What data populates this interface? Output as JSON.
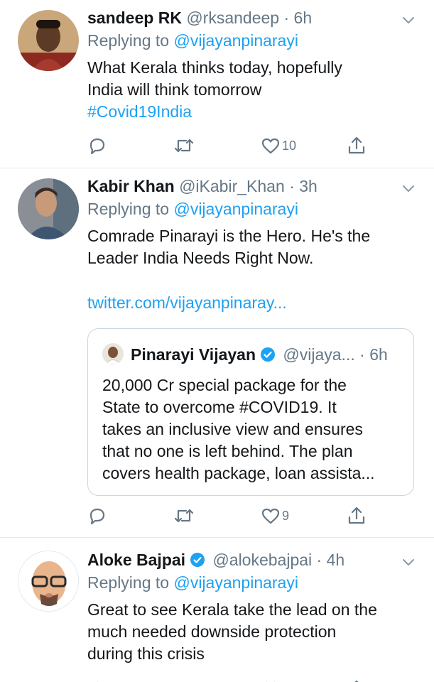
{
  "tweets": [
    {
      "name": "sandeep RK",
      "handle": "@rksandeep",
      "time": "6h",
      "replying_prefix": "Replying to ",
      "replying_to": "@vijayanpinarayi",
      "text": "What Kerala thinks today, hopefully\nIndia will think tomorrow",
      "hashtag": "#Covid19India",
      "like_count": "10"
    },
    {
      "name": "Kabir Khan",
      "handle": "@iKabir_Khan",
      "time": "3h",
      "replying_prefix": "Replying to ",
      "replying_to": "@vijayanpinarayi",
      "text": "Comrade Pinarayi is the Hero. He's the\nLeader India Needs Right Now.",
      "link": "twitter.com/vijayanpinaray...",
      "like_count": "9",
      "quote": {
        "name": "Pinarayi Vijayan",
        "handle": "@vijaya...",
        "time": "6h",
        "text": "20,000 Cr special package for the\nState to overcome #COVID19. It\ntakes an inclusive view and ensures\nthat no one is left behind. The plan\ncovers health package, loan assista..."
      }
    },
    {
      "name": "Aloke Bajpai",
      "handle": "@alokebajpai",
      "time": "4h",
      "replying_prefix": "Replying to ",
      "replying_to": "@vijayanpinarayi",
      "text": "Great to see Kerala take the lead on the\nmuch needed downside protection\nduring this crisis"
    }
  ],
  "separator": " · ",
  "colors": {
    "accent": "#1da1f2",
    "muted": "#657786",
    "divider": "#e1e8ed"
  },
  "icons": [
    "reply-icon",
    "retweet-icon",
    "like-icon",
    "share-icon",
    "chevron-down-icon",
    "verified-icon"
  ]
}
